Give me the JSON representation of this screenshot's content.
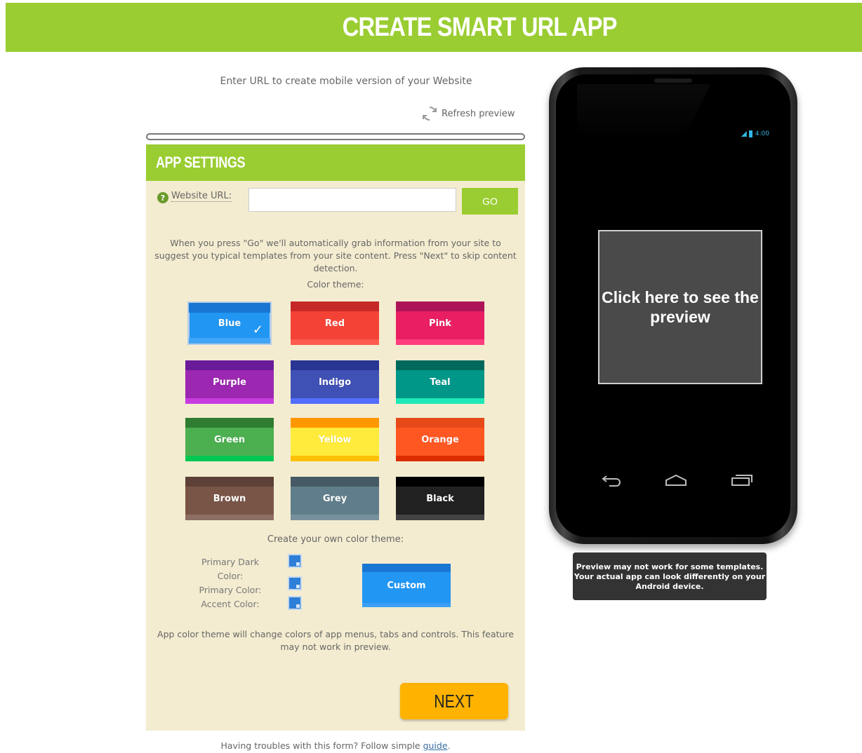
{
  "header": {
    "title": "CREATE SMART URL APP"
  },
  "intro": {
    "text": "Enter URL to create mobile version of your Website"
  },
  "refresh": {
    "label": "Refresh preview"
  },
  "panel": {
    "title": "APP SETTINGS",
    "url_label": "Website URL:",
    "url_value": "",
    "go_label": "GO",
    "description": "When you press \"Go\" we'll automatically grab information from your site to suggest you typical templates from your site content. Press \"Next\" to skip content detection.",
    "color_theme_label": "Color theme:",
    "themes": [
      {
        "name": "Blue",
        "main": "#2196f3",
        "top": "#1976d2",
        "bottom": "#42a5f5",
        "selected": true
      },
      {
        "name": "Red",
        "main": "#f44336",
        "top": "#c62828",
        "bottom": "#ff5a4f"
      },
      {
        "name": "Pink",
        "main": "#e91e63",
        "top": "#ad1457",
        "bottom": "#ff3d7f"
      },
      {
        "name": "Purple",
        "main": "#9c27b0",
        "top": "#6a1b9a",
        "bottom": "#c83be0"
      },
      {
        "name": "Indigo",
        "main": "#3f51b5",
        "top": "#283593",
        "bottom": "#536dfe"
      },
      {
        "name": "Teal",
        "main": "#009688",
        "top": "#00695c",
        "bottom": "#1de9b6"
      },
      {
        "name": "Green",
        "main": "#4caf50",
        "top": "#2e7d32",
        "bottom": "#00c853"
      },
      {
        "name": "Yellow",
        "main": "#ffeb3b",
        "top": "#ff9800",
        "bottom": "#ffc107"
      },
      {
        "name": "Orange",
        "main": "#ff5722",
        "top": "#e64a19",
        "bottom": "#dd2c00"
      },
      {
        "name": "Brown",
        "main": "#795548",
        "top": "#5d4037",
        "bottom": "#8d6e63"
      },
      {
        "name": "Grey",
        "main": "#607d8b",
        "top": "#455a64",
        "bottom": "#78909c"
      },
      {
        "name": "Black",
        "main": "#212121",
        "top": "#000000",
        "bottom": "#424242"
      }
    ],
    "own_theme_label": "Create your own color theme:",
    "primary_dark_label": "Primary Dark Color:",
    "primary_label": "Primary Color:",
    "accent_label": "Accent Color:",
    "custom_label": "Custom",
    "note": "App color theme will change colors of app menus, tabs and controls. This feature may not work in preview.",
    "next_label": "NEXT"
  },
  "footer": {
    "text": "Having troubles with this form? Follow simple ",
    "link": "guide",
    "suffix": "."
  },
  "phone": {
    "status_time": "4:00",
    "preview_text": "Click here to see the preview",
    "nav_back": "back-icon",
    "nav_home": "home-icon",
    "nav_recent": "recent-apps-icon"
  },
  "warning": {
    "text": "Preview may not work for some templates. Your actual app can look differently on your Android device."
  }
}
